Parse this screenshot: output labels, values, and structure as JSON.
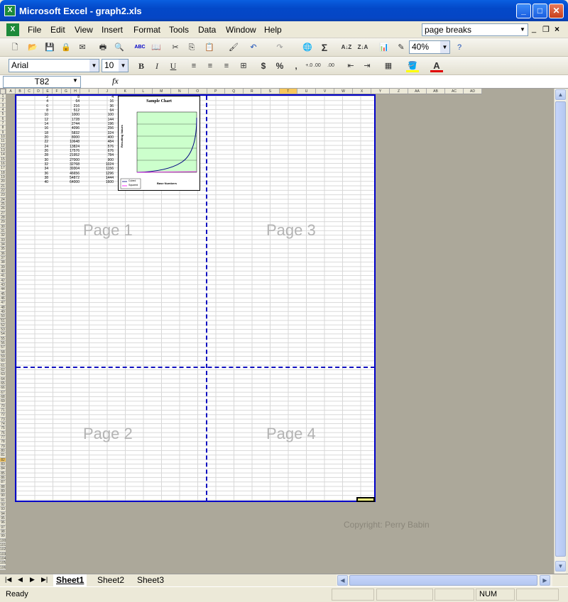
{
  "window": {
    "title": "Microsoft Excel - graph2.xls"
  },
  "menu": {
    "items": [
      {
        "label": "File",
        "key": "F"
      },
      {
        "label": "Edit",
        "key": "E"
      },
      {
        "label": "View",
        "key": "V"
      },
      {
        "label": "Insert",
        "key": "I"
      },
      {
        "label": "Format",
        "key": "o"
      },
      {
        "label": "Tools",
        "key": "T"
      },
      {
        "label": "Data",
        "key": "D"
      },
      {
        "label": "Window",
        "key": "W"
      },
      {
        "label": "Help",
        "key": "H"
      }
    ],
    "help_box": "page breaks"
  },
  "toolbar": {
    "zoom": "40%",
    "font": "Arial",
    "font_size": "10",
    "bold": "B",
    "italic": "I",
    "underline": "U",
    "currency": "$",
    "percent": "%",
    "comma": ",",
    "increase_decimal": "+.0 .00",
    "decrease_decimal": ".00 →.0",
    "sigma": "Σ"
  },
  "formula_bar": {
    "name_box": "T82",
    "fx": "fx",
    "value": ""
  },
  "sheet": {
    "page_labels": [
      "Page 1",
      "Page 2",
      "Page 3",
      "Page 4"
    ],
    "copyright": "Copyright: Perry Babin",
    "chart_title": "Sample Chart",
    "chart_xlabel": "Base Numbers",
    "chart_ylabel": "Resulting Values",
    "chart_legend": [
      "Cubed",
      "Squared"
    ],
    "col_a": [
      "2",
      "4",
      "6",
      "8",
      "10",
      "12",
      "14",
      "16",
      "18",
      "20",
      "22",
      "24",
      "26",
      "28",
      "30",
      "32",
      "34",
      "36",
      "38",
      "40"
    ],
    "col_d": [
      "8",
      "64",
      "216",
      "512",
      "1000",
      "1728",
      "2744",
      "4096",
      "5832",
      "8000",
      "10648",
      "13824",
      "17576",
      "21952",
      "27000",
      "32768",
      "39304",
      "46656",
      "54872",
      "64000"
    ],
    "col_f": [
      "4",
      "16",
      "36",
      "64",
      "100",
      "144",
      "196",
      "256",
      "324",
      "400",
      "484",
      "576",
      "676",
      "784",
      "900",
      "1024",
      "1156",
      "1296",
      "1444",
      "1600"
    ]
  },
  "tabs": {
    "sheets": [
      "Sheet1",
      "Sheet2",
      "Sheet3"
    ]
  },
  "status": {
    "text": "Ready",
    "num": "NUM"
  }
}
